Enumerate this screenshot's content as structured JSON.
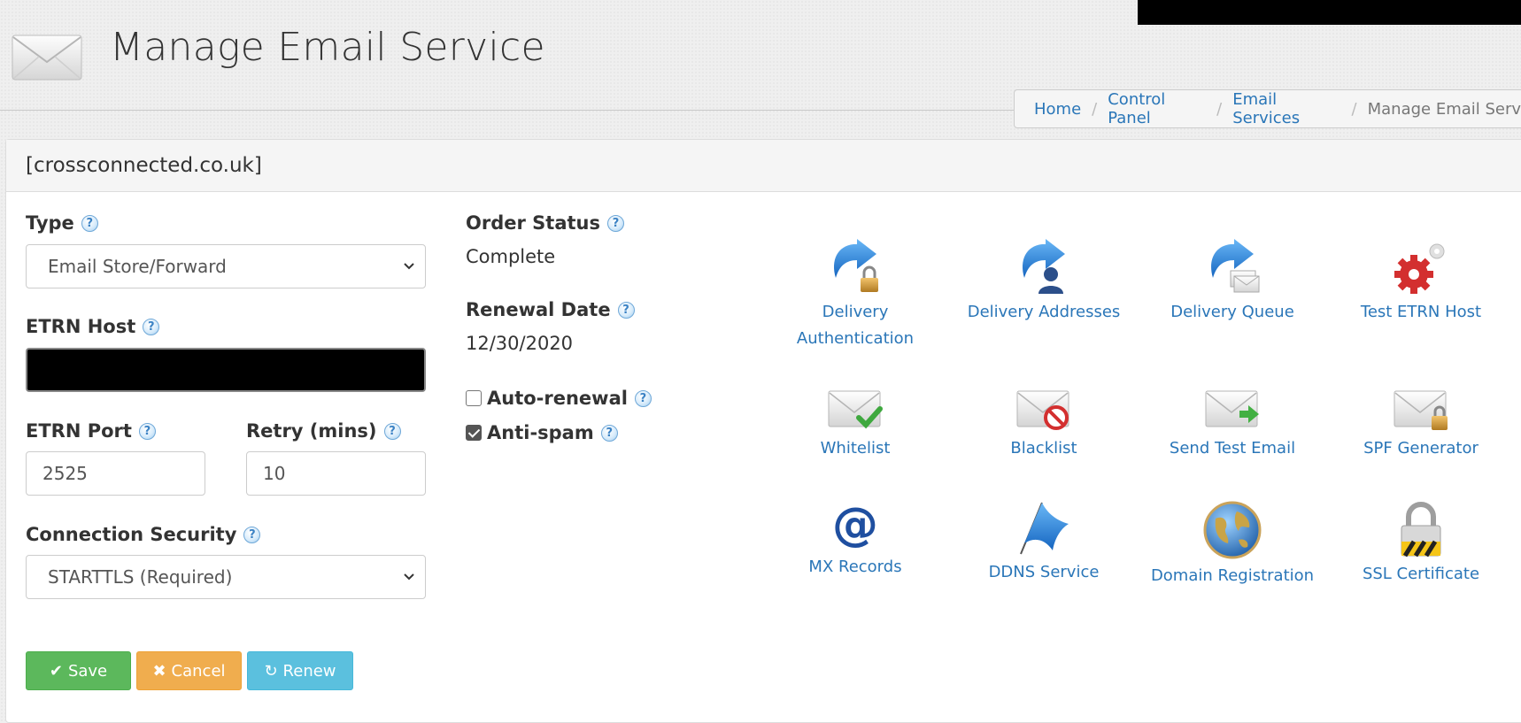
{
  "page": {
    "title": "Manage Email Service"
  },
  "breadcrumb": {
    "items": [
      "Home",
      "Control Panel",
      "Email Services"
    ],
    "current": "Manage Email Service"
  },
  "panel": {
    "heading": "[crossconnected.co.uk]"
  },
  "form": {
    "type_label": "Type",
    "type_value": "Email Store/Forward",
    "etrn_host_label": "ETRN Host",
    "etrn_port_label": "ETRN Port",
    "etrn_port_value": "2525",
    "retry_label": "Retry (mins)",
    "retry_value": "10",
    "security_label": "Connection Security",
    "security_value": "STARTTLS (Required)"
  },
  "status": {
    "order_status_label": "Order Status",
    "order_status_value": "Complete",
    "renewal_label": "Renewal Date",
    "renewal_value": "12/30/2020",
    "auto_renewal_label": "Auto-renewal",
    "auto_renewal_checked": false,
    "antispam_label": "Anti-spam",
    "antispam_checked": true
  },
  "buttons": {
    "save": "Save",
    "cancel": "Cancel",
    "renew": "Renew"
  },
  "tools": [
    {
      "label": "Delivery Authentication",
      "icon": "delivery-authentication-icon"
    },
    {
      "label": "Delivery Addresses",
      "icon": "delivery-addresses-icon"
    },
    {
      "label": "Delivery Queue",
      "icon": "delivery-queue-icon"
    },
    {
      "label": "Test ETRN Host",
      "icon": "gears-icon"
    },
    {
      "label": "Whitelist",
      "icon": "envelope-check-icon"
    },
    {
      "label": "Blacklist",
      "icon": "envelope-block-icon"
    },
    {
      "label": "Send Test Email",
      "icon": "envelope-send-icon"
    },
    {
      "label": "SPF Generator",
      "icon": "envelope-lock-icon"
    },
    {
      "label": "MX Records",
      "icon": "at-sign-icon"
    },
    {
      "label": "DDNS Service",
      "icon": "flag-icon"
    },
    {
      "label": "Domain Registration",
      "icon": "globe-icon"
    },
    {
      "label": "SSL Certificate",
      "icon": "padlock-icon"
    }
  ],
  "colors": {
    "link": "#2a76b8",
    "save": "#5cb85c",
    "cancel": "#f0ad4e",
    "renew": "#5bc0de"
  }
}
